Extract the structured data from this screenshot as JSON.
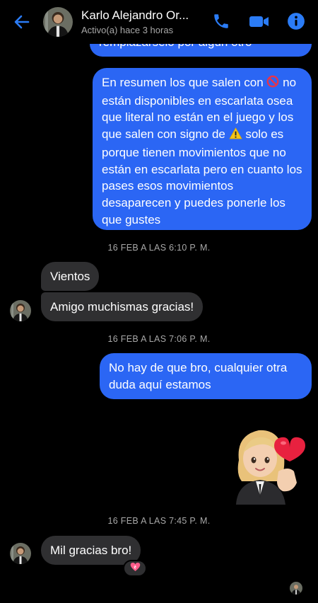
{
  "header": {
    "name": "Karlo Alejandro Or...",
    "status": "Activo(a) hace 3 horas"
  },
  "messages": {
    "m0": "remplazarselo por algún otro",
    "m1_a": "En resumen los que salen con ",
    "m1_b": "no están disponibles en escarlata osea que literal no están en el juego y los que salen con signo de ",
    "m1_c": " solo es porque tienen movimientos que no están en escarlata pero en cuanto los pases esos movimientos desaparecen y puedes ponerle los que gustes",
    "ts1": "16 FEB A LAS 6:10 P. M.",
    "m2": "Vientos",
    "m3": "Amigo muchismas gracias!",
    "ts2": "16 FEB A LAS 7:06 P. M.",
    "m4": "No hay de que bro, cualquier otra duda aquí estamos",
    "ts3": "16 FEB A LAS 7:45 P. M.",
    "m5": "Mil gracias bro!",
    "reaction": "💖"
  },
  "colors": {
    "accent": "#2b66f4",
    "outgoing": "#2b66f4",
    "incoming": "#2f2f31",
    "background": "#000000"
  },
  "icons": [
    "back-arrow-icon",
    "phone-icon",
    "video-camera-icon",
    "info-icon",
    "prohibited-icon",
    "warning-icon"
  ]
}
